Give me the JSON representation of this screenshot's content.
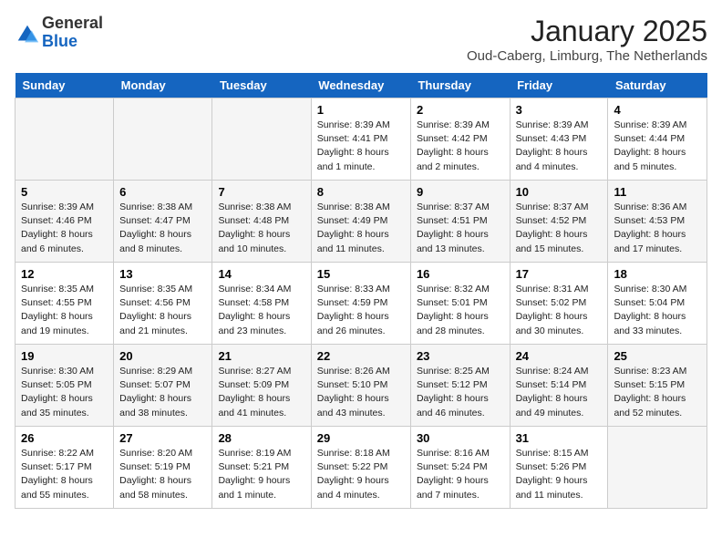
{
  "header": {
    "logo_general": "General",
    "logo_blue": "Blue",
    "title": "January 2025",
    "subtitle": "Oud-Caberg, Limburg, The Netherlands"
  },
  "weekdays": [
    "Sunday",
    "Monday",
    "Tuesday",
    "Wednesday",
    "Thursday",
    "Friday",
    "Saturday"
  ],
  "weeks": [
    [
      {
        "day": "",
        "info": ""
      },
      {
        "day": "",
        "info": ""
      },
      {
        "day": "",
        "info": ""
      },
      {
        "day": "1",
        "info": "Sunrise: 8:39 AM\nSunset: 4:41 PM\nDaylight: 8 hours\nand 1 minute."
      },
      {
        "day": "2",
        "info": "Sunrise: 8:39 AM\nSunset: 4:42 PM\nDaylight: 8 hours\nand 2 minutes."
      },
      {
        "day": "3",
        "info": "Sunrise: 8:39 AM\nSunset: 4:43 PM\nDaylight: 8 hours\nand 4 minutes."
      },
      {
        "day": "4",
        "info": "Sunrise: 8:39 AM\nSunset: 4:44 PM\nDaylight: 8 hours\nand 5 minutes."
      }
    ],
    [
      {
        "day": "5",
        "info": "Sunrise: 8:39 AM\nSunset: 4:46 PM\nDaylight: 8 hours\nand 6 minutes."
      },
      {
        "day": "6",
        "info": "Sunrise: 8:38 AM\nSunset: 4:47 PM\nDaylight: 8 hours\nand 8 minutes."
      },
      {
        "day": "7",
        "info": "Sunrise: 8:38 AM\nSunset: 4:48 PM\nDaylight: 8 hours\nand 10 minutes."
      },
      {
        "day": "8",
        "info": "Sunrise: 8:38 AM\nSunset: 4:49 PM\nDaylight: 8 hours\nand 11 minutes."
      },
      {
        "day": "9",
        "info": "Sunrise: 8:37 AM\nSunset: 4:51 PM\nDaylight: 8 hours\nand 13 minutes."
      },
      {
        "day": "10",
        "info": "Sunrise: 8:37 AM\nSunset: 4:52 PM\nDaylight: 8 hours\nand 15 minutes."
      },
      {
        "day": "11",
        "info": "Sunrise: 8:36 AM\nSunset: 4:53 PM\nDaylight: 8 hours\nand 17 minutes."
      }
    ],
    [
      {
        "day": "12",
        "info": "Sunrise: 8:35 AM\nSunset: 4:55 PM\nDaylight: 8 hours\nand 19 minutes."
      },
      {
        "day": "13",
        "info": "Sunrise: 8:35 AM\nSunset: 4:56 PM\nDaylight: 8 hours\nand 21 minutes."
      },
      {
        "day": "14",
        "info": "Sunrise: 8:34 AM\nSunset: 4:58 PM\nDaylight: 8 hours\nand 23 minutes."
      },
      {
        "day": "15",
        "info": "Sunrise: 8:33 AM\nSunset: 4:59 PM\nDaylight: 8 hours\nand 26 minutes."
      },
      {
        "day": "16",
        "info": "Sunrise: 8:32 AM\nSunset: 5:01 PM\nDaylight: 8 hours\nand 28 minutes."
      },
      {
        "day": "17",
        "info": "Sunrise: 8:31 AM\nSunset: 5:02 PM\nDaylight: 8 hours\nand 30 minutes."
      },
      {
        "day": "18",
        "info": "Sunrise: 8:30 AM\nSunset: 5:04 PM\nDaylight: 8 hours\nand 33 minutes."
      }
    ],
    [
      {
        "day": "19",
        "info": "Sunrise: 8:30 AM\nSunset: 5:05 PM\nDaylight: 8 hours\nand 35 minutes."
      },
      {
        "day": "20",
        "info": "Sunrise: 8:29 AM\nSunset: 5:07 PM\nDaylight: 8 hours\nand 38 minutes."
      },
      {
        "day": "21",
        "info": "Sunrise: 8:27 AM\nSunset: 5:09 PM\nDaylight: 8 hours\nand 41 minutes."
      },
      {
        "day": "22",
        "info": "Sunrise: 8:26 AM\nSunset: 5:10 PM\nDaylight: 8 hours\nand 43 minutes."
      },
      {
        "day": "23",
        "info": "Sunrise: 8:25 AM\nSunset: 5:12 PM\nDaylight: 8 hours\nand 46 minutes."
      },
      {
        "day": "24",
        "info": "Sunrise: 8:24 AM\nSunset: 5:14 PM\nDaylight: 8 hours\nand 49 minutes."
      },
      {
        "day": "25",
        "info": "Sunrise: 8:23 AM\nSunset: 5:15 PM\nDaylight: 8 hours\nand 52 minutes."
      }
    ],
    [
      {
        "day": "26",
        "info": "Sunrise: 8:22 AM\nSunset: 5:17 PM\nDaylight: 8 hours\nand 55 minutes."
      },
      {
        "day": "27",
        "info": "Sunrise: 8:20 AM\nSunset: 5:19 PM\nDaylight: 8 hours\nand 58 minutes."
      },
      {
        "day": "28",
        "info": "Sunrise: 8:19 AM\nSunset: 5:21 PM\nDaylight: 9 hours\nand 1 minute."
      },
      {
        "day": "29",
        "info": "Sunrise: 8:18 AM\nSunset: 5:22 PM\nDaylight: 9 hours\nand 4 minutes."
      },
      {
        "day": "30",
        "info": "Sunrise: 8:16 AM\nSunset: 5:24 PM\nDaylight: 9 hours\nand 7 minutes."
      },
      {
        "day": "31",
        "info": "Sunrise: 8:15 AM\nSunset: 5:26 PM\nDaylight: 9 hours\nand 11 minutes."
      },
      {
        "day": "",
        "info": ""
      }
    ]
  ]
}
